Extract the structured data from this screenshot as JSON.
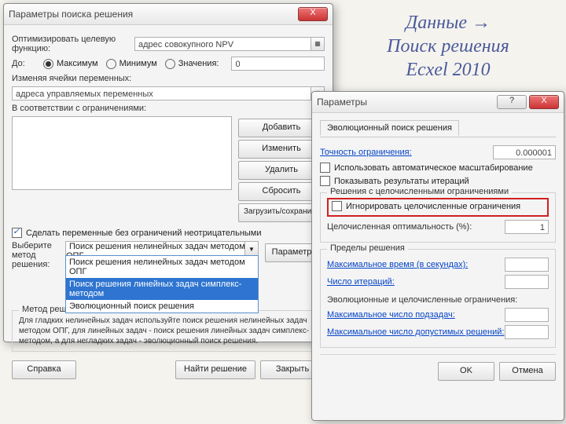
{
  "caption": {
    "l1": "Данные →",
    "l2": "Поиск решения",
    "l3": "Ecxel 2010"
  },
  "d1": {
    "title": "Параметры поиска решения",
    "close": "X",
    "optLabel": "Оптимизировать целевую функцию:",
    "optVal": "адрес совокупного NPV",
    "toLabel": "До:",
    "rMax": "Максимум",
    "rMin": "Минимум",
    "rVal": "Значения:",
    "valField": "0",
    "chVarLabel": "Изменяя ячейки переменных:",
    "chVarVal": "адреса управляемых переменных",
    "constrLabel": "В соответствии с ограничениями:",
    "bAdd": "Добавить",
    "bEdit": "Изменить",
    "bDel": "Удалить",
    "bReset": "Сбросить",
    "bLoad": "Загрузить/сохранить",
    "chkNonneg": "Сделать переменные без ограничений неотрицательными",
    "selLabelA": "Выберите",
    "selLabelB": "метод решения:",
    "ddVal": "Поиск решения нелинейных задач методом ОПГ",
    "opt1": "Поиск решения нелинейных задач методом ОПГ",
    "opt2": "Поиск решения линейных задач симплекс-методом",
    "opt3": "Эволюционный поиск решения",
    "bParams": "Параметры",
    "methodHdr": "Метод решения",
    "methodTxt": "Для гладких нелинейных задач используйте поиск решения нелинейных задач методом ОПГ, для линейных задач - поиск решения линейных задач симплекс-методом, а для негладких задач - эволюционный поиск решения.",
    "bHelp": "Справка",
    "bSolve": "Найти решение",
    "bClose": "Закрыть"
  },
  "d2": {
    "title": "Параметры",
    "help": "?",
    "close": "X",
    "tab": "Эволюционный поиск решения",
    "precLabel": "Точность ограничения:",
    "precVal": "0.000001",
    "chkScale": "Использовать автоматическое масштабирование",
    "chkIter": "Показывать результаты итераций",
    "grpInt": "Решения с целочисленными ограничениями",
    "chkIgnore": "Игнорировать целочисленные ограничения",
    "optLabel": "Целочисленная оптимальность (%):",
    "optVal": "1",
    "grpLim": "Пределы решения",
    "timeLabel": "Максимальное время (в секундах):",
    "iterLabel": "Число итераций:",
    "evLabel": "Эволюционные и целочисленные ограничения:",
    "subLabel": "Максимальное число подзадач:",
    "feasLabel": "Максимальное число допустимых решений:",
    "bOk": "OK",
    "bCancel": "Отмена"
  }
}
